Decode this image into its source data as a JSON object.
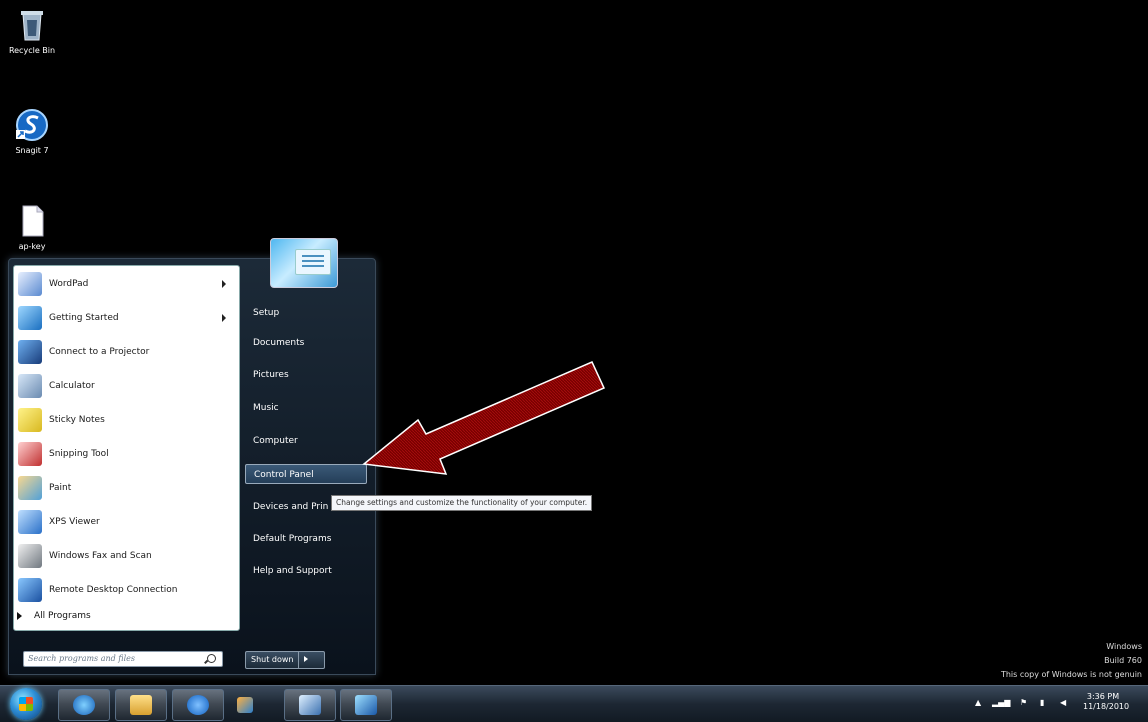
{
  "desktop": {
    "icons": [
      {
        "label": "Recycle Bin",
        "icon": "recycle-bin-icon"
      },
      {
        "label": "Snagit 7",
        "icon": "snagit-icon"
      },
      {
        "label": "ap-key",
        "icon": "text-file-icon"
      }
    ]
  },
  "start_menu": {
    "programs": [
      {
        "label": "WordPad",
        "icon": "wordpad-icon",
        "submenu": true
      },
      {
        "label": "Getting Started",
        "icon": "getting-started-icon",
        "submenu": true
      },
      {
        "label": "Connect to a Projector",
        "icon": "projector-icon",
        "submenu": false
      },
      {
        "label": "Calculator",
        "icon": "calculator-icon",
        "submenu": false
      },
      {
        "label": "Sticky Notes",
        "icon": "sticky-notes-icon",
        "submenu": false
      },
      {
        "label": "Snipping Tool",
        "icon": "scissors-icon",
        "submenu": false
      },
      {
        "label": "Paint",
        "icon": "paint-icon",
        "submenu": false
      },
      {
        "label": "XPS Viewer",
        "icon": "xps-viewer-icon",
        "submenu": false
      },
      {
        "label": "Windows Fax and Scan",
        "icon": "fax-icon",
        "submenu": false
      },
      {
        "label": "Remote Desktop Connection",
        "icon": "remote-desktop-icon",
        "submenu": false
      }
    ],
    "all_programs": "All Programs",
    "search_placeholder": "Search programs and files",
    "right_items": [
      "Setup",
      "Documents",
      "Pictures",
      "Music",
      "Computer",
      "Control Panel",
      "Devices and Prin",
      "Default Programs",
      "Help and Support"
    ],
    "highlighted": "Control Panel",
    "shutdown_label": "Shut down"
  },
  "tooltip": "Change settings and customize the functionality of your computer.",
  "taskbar": {
    "pinned": [
      "internet-explorer-icon",
      "windows-explorer-icon",
      "snagit-icon",
      "media-player-icon",
      "control-panel-icon",
      "remote-desktop-icon"
    ],
    "time": "3:36 PM",
    "date": "11/18/2010"
  },
  "watermark": {
    "line1": "Windows",
    "line2": "Build 760",
    "line3": "This copy of Windows is not genuin"
  },
  "colors": {
    "desktop_bg": "#000000",
    "arrow_fill": "#7a0000",
    "highlight": "#243e58"
  }
}
